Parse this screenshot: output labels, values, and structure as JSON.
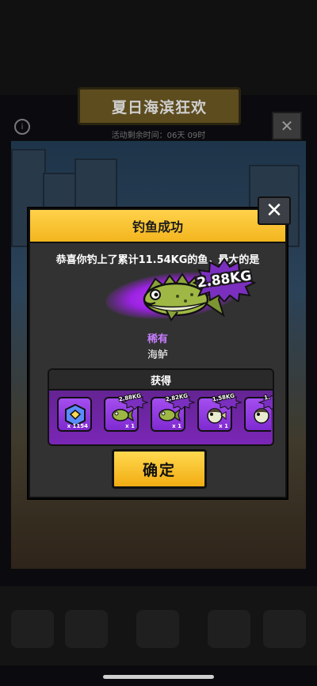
{
  "background": {
    "banner_title": "夏日海滨狂欢",
    "timer_text": "活动剩余时间：06天 09时",
    "close_icon": "close-icon",
    "info_icon": "info-icon"
  },
  "modal": {
    "title": "钓鱼成功",
    "congrats_text": "恭喜你钓上了累计11.54KG的鱼，最大的是",
    "largest_weight": "2.88KG",
    "rarity": "稀有",
    "fish_name": "海鲈",
    "reward_title": "获得",
    "rewards": [
      {
        "icon": "gem-badge-icon",
        "count": "x 1154"
      },
      {
        "icon": "sea-bass-icon",
        "count": "x 1",
        "weight": "2.88KG"
      },
      {
        "icon": "sea-bass-icon",
        "count": "x 1",
        "weight": "2.82KG"
      },
      {
        "icon": "pufferfish-icon",
        "count": "x 1",
        "weight": "1.58KG"
      },
      {
        "icon": "pufferfish-icon",
        "count": "",
        "weight": "1."
      }
    ],
    "confirm_label": "确定"
  },
  "colors": {
    "header_yellow": "#f3b51e",
    "rarity_purple": "#c77dff",
    "panel_purple": "#7a26b6",
    "modal_bg": "#323232"
  }
}
